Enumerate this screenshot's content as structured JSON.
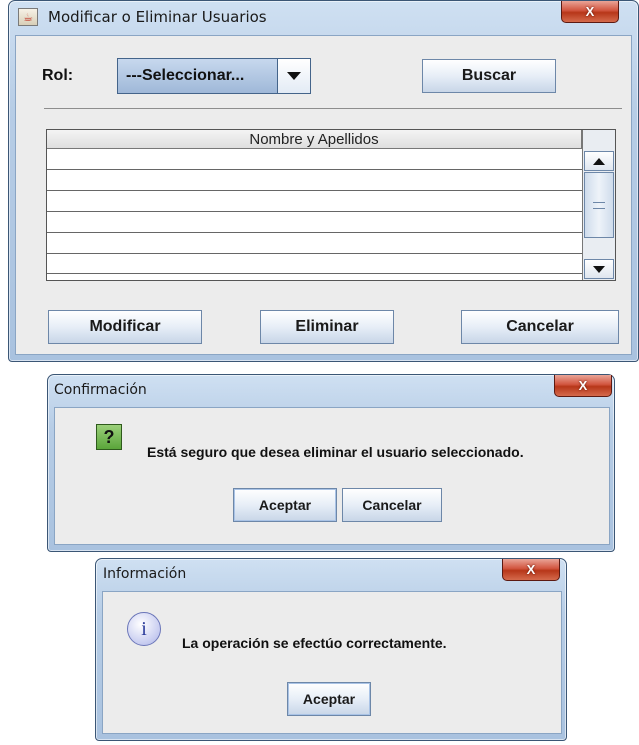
{
  "main_window": {
    "title": "Modificar o Eliminar Usuarios",
    "close_glyph": "X",
    "role_label": "Rol:",
    "role_combo_value": "---Seleccionar...",
    "search_button": "Buscar",
    "table": {
      "columns": [
        "Nombre y Apellidos"
      ],
      "rows": [
        "",
        "",
        "",
        "",
        "",
        ""
      ]
    },
    "buttons": {
      "modify": "Modificar",
      "delete": "Eliminar",
      "cancel": "Cancelar"
    }
  },
  "confirm_dialog": {
    "title": "Confirmación",
    "close_glyph": "X",
    "icon": "question-icon",
    "icon_glyph": "?",
    "message": "Está seguro que desea eliminar el usuario seleccionado.",
    "accept_button": "Aceptar",
    "cancel_button": "Cancelar"
  },
  "info_dialog": {
    "title": "Información",
    "close_glyph": "X",
    "icon": "info-icon",
    "icon_glyph": "i",
    "message": "La operación se efectúo correctamente.",
    "accept_button": "Aceptar"
  }
}
